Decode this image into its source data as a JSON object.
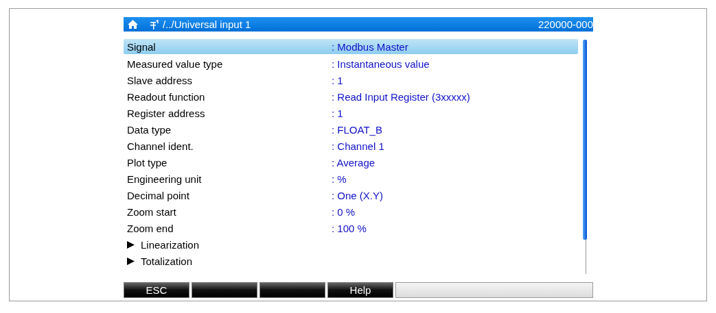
{
  "header": {
    "path": "/../Universal input 1",
    "code": "220000-000"
  },
  "rows": [
    {
      "kind": "value",
      "label": "Signal",
      "value": ": Modbus Master",
      "selected": true
    },
    {
      "kind": "value",
      "label": "Measured value type",
      "value": ": Instantaneous value",
      "selected": false
    },
    {
      "kind": "value",
      "label": "Slave address",
      "value": ": 1",
      "selected": false
    },
    {
      "kind": "value",
      "label": "Readout function",
      "value": ": Read Input Register (3xxxxx)",
      "selected": false
    },
    {
      "kind": "value",
      "label": "Register address",
      "value": ": 1",
      "selected": false
    },
    {
      "kind": "value",
      "label": "Data type",
      "value": ": FLOAT_B",
      "selected": false
    },
    {
      "kind": "value",
      "label": "Channel ident.",
      "value": ": Channel 1",
      "selected": false
    },
    {
      "kind": "value",
      "label": "Plot type",
      "value": ": Average",
      "selected": false
    },
    {
      "kind": "value",
      "label": "Engineering unit",
      "value": ": %",
      "selected": false
    },
    {
      "kind": "value",
      "label": "Decimal point",
      "value": ": One (X.Y)",
      "selected": false
    },
    {
      "kind": "value",
      "label": "Zoom start",
      "value": ": 0 %",
      "selected": false
    },
    {
      "kind": "value",
      "label": "Zoom end",
      "value": ": 100 %",
      "selected": false
    },
    {
      "kind": "submenu",
      "label": "Linearization",
      "selected": false
    },
    {
      "kind": "submenu",
      "label": "Totalization",
      "selected": false
    }
  ],
  "softkeys": [
    {
      "kind": "labeled",
      "label": "ESC"
    },
    {
      "kind": "blank"
    },
    {
      "kind": "blank"
    },
    {
      "kind": "labeled",
      "label": "Help"
    }
  ]
}
